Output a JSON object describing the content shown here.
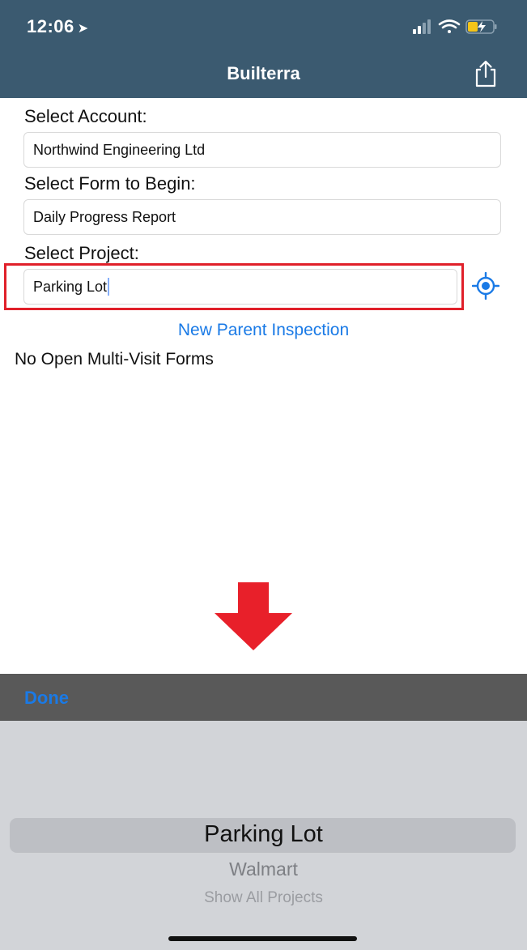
{
  "status_bar": {
    "time": "12:06",
    "location_icon": "location-arrow-icon",
    "signal_icon": "cellular-signal-icon",
    "wifi_icon": "wifi-icon",
    "battery_icon": "battery-charging-icon"
  },
  "nav": {
    "title": "Builterra",
    "share_icon": "share-icon"
  },
  "form": {
    "account_label": "Select Account:",
    "account_value": "Northwind Engineering Ltd",
    "form_label": "Select Form to Begin:",
    "form_value": "Daily Progress Report",
    "project_label": "Select Project:",
    "project_value": "Parking Lot",
    "locate_icon": "target-location-icon"
  },
  "link": {
    "new_parent_inspection": "New Parent Inspection"
  },
  "empty_state": {
    "text": "No Open Multi-Visit Forms"
  },
  "picker": {
    "done_label": "Done",
    "options": [
      "Parking Lot",
      "Walmart",
      "Show All Projects"
    ],
    "selected": "Parking Lot"
  },
  "colors": {
    "header": "#3b5a70",
    "accent": "#1a7ae6",
    "highlight": "#e0202a",
    "arrow": "#e8202a",
    "toolbar": "#595959",
    "picker": "#d2d4d8"
  }
}
